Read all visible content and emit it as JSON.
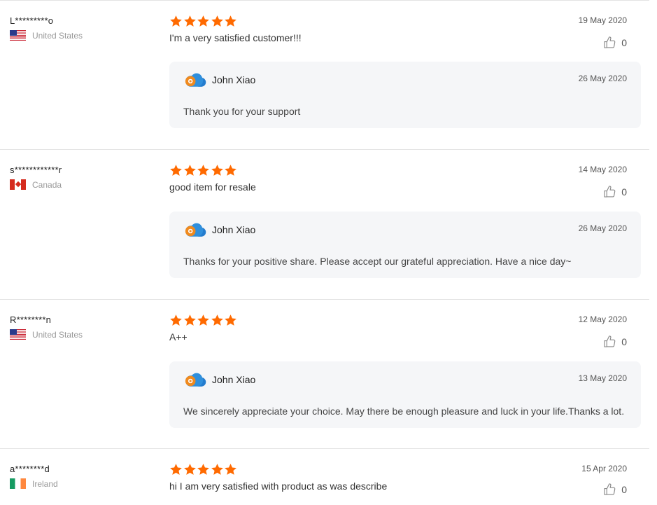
{
  "colors": {
    "star": "#ff6a00",
    "reply_bg": "#f5f6f8",
    "divider": "#e3e3e3"
  },
  "icons": {
    "star": "star-icon",
    "like": "thumbs-up-icon",
    "seller_logo": "cloud-logo-icon"
  },
  "reviews": [
    {
      "buyer": "L*********o",
      "country": "United States",
      "flag": "us-flag-icon",
      "rating": 5,
      "date": "19 May 2020",
      "text": "I'm a very satisfied customer!!!",
      "likes": "0",
      "reply": {
        "seller": "John Xiao",
        "date": "26 May 2020",
        "text": "Thank you for your support"
      }
    },
    {
      "buyer": "s************r",
      "country": "Canada",
      "flag": "canada-flag-icon",
      "rating": 5,
      "date": "14 May 2020",
      "text": "good item for resale",
      "likes": "0",
      "reply": {
        "seller": "John Xiao",
        "date": "26 May 2020",
        "text": "Thanks for your positive share. Please accept our grateful appreciation. Have a nice day~"
      }
    },
    {
      "buyer": "R********n",
      "country": "United States",
      "flag": "us-flag-icon",
      "rating": 5,
      "date": "12 May 2020",
      "text": "A++",
      "likes": "0",
      "reply": {
        "seller": "John Xiao",
        "date": "13 May 2020",
        "text": "We sincerely appreciate your choice. May there be enough pleasure and luck in your life.Thanks a lot."
      }
    },
    {
      "buyer": "a********d",
      "country": "Ireland",
      "flag": "ireland-flag-icon",
      "rating": 5,
      "date": "15 Apr 2020",
      "text": "hi I am very satisfied with product as was describe",
      "likes": "0"
    }
  ]
}
